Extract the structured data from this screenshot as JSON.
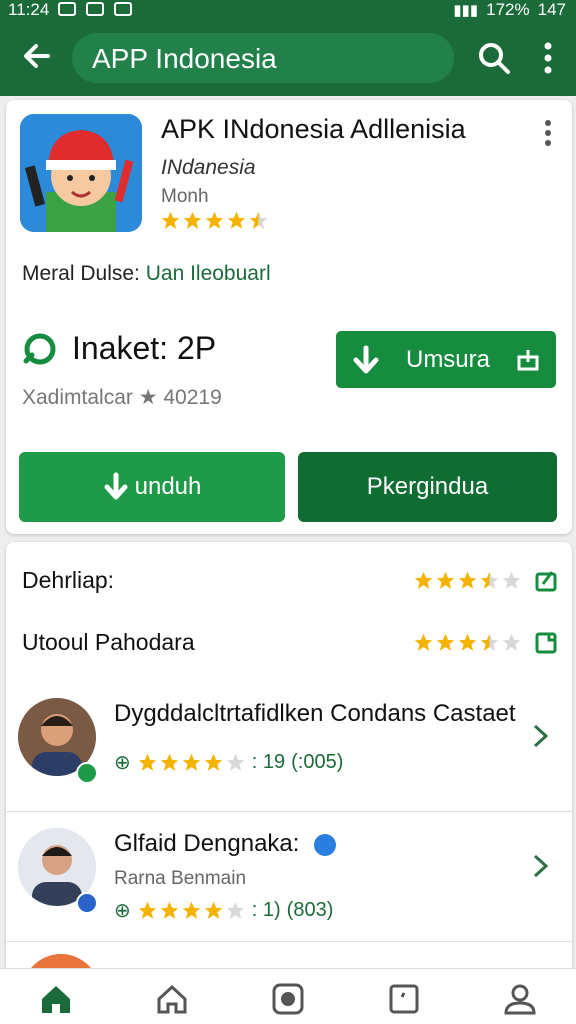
{
  "status_bar": {
    "time": "11:24",
    "battery": "172%",
    "clock_right": "147"
  },
  "app_bar": {
    "title": "APP Indonesia"
  },
  "app": {
    "name": "APK INdonesia Adllenisia",
    "subtitle": "INdanesia",
    "developer": "Monh",
    "rating_stars": 4.5,
    "meta_label": "Meral Dulse:",
    "meta_link": "Uan Ileobuarl",
    "market_label": "Inaket: 2P",
    "reviews_label": "Xadimtalcar ★ 40219",
    "install_label": "Umsura",
    "download_label": "unduh",
    "secondary_label": "Pkergindua"
  },
  "ratings": [
    {
      "label": "Dehrliap:",
      "stars": 3.5
    },
    {
      "label": "Utooul Pahodara",
      "stars": 3.5
    }
  ],
  "reviewers": [
    {
      "name": "Dygddalcltrtafidlken Condans Castaet",
      "subtitle": "",
      "stats": ": 19",
      "count": "(:005)",
      "stars": 4
    },
    {
      "name": "Glfaid Dengnaka:",
      "subtitle": "Rarna Benmain",
      "stats": ": 1)",
      "count": "(803)",
      "stars": 4
    }
  ],
  "colors": {
    "primary": "#1b6b3a",
    "button_green": "#1f9a49",
    "star": "#f5b301"
  },
  "bottom_nav": [
    "home-icon",
    "house-outline-icon",
    "record-icon",
    "tablet-icon",
    "profile-icon"
  ]
}
